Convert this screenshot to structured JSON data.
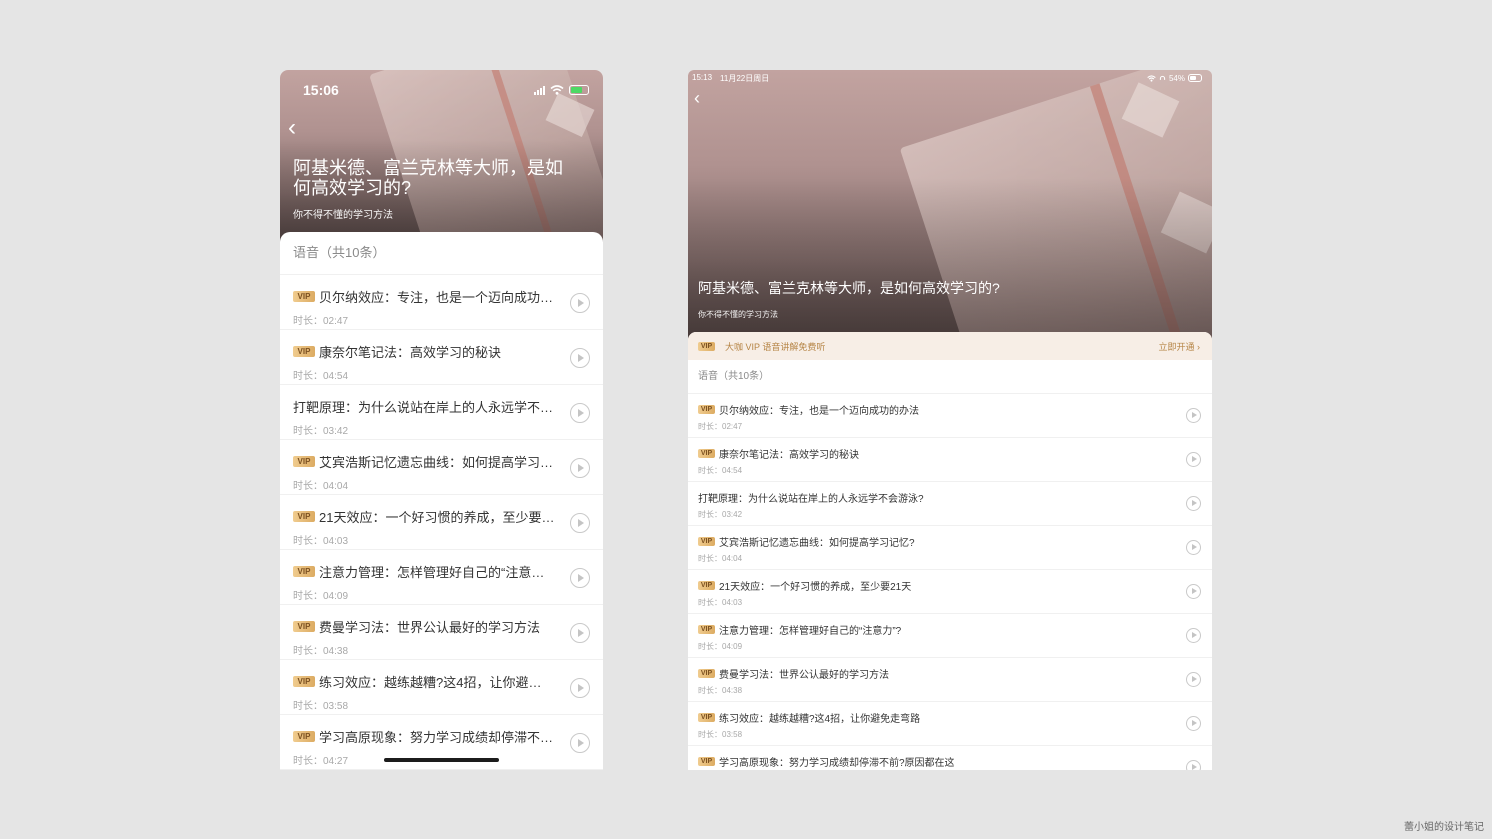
{
  "phone": {
    "status": {
      "time": "15:06"
    },
    "back_label": "‹",
    "title": "阿基米德、富兰克林等大师，是如何高效学习的?",
    "subtitle": "你不得不懂的学习方法",
    "section_label": "语音（共10条）",
    "vip_badge": "VIP",
    "items": [
      {
        "vip": true,
        "title": "贝尔纳效应：专注，也是一个迈向成功…",
        "duration": "时长：02:47"
      },
      {
        "vip": true,
        "title": "康奈尔笔记法：高效学习的秘诀",
        "duration": "时长：04:54"
      },
      {
        "vip": false,
        "title": "打靶原理：为什么说站在岸上的人永远学不…",
        "duration": "时长：03:42"
      },
      {
        "vip": true,
        "title": "艾宾浩斯记忆遗忘曲线：如何提高学习…",
        "duration": "时长：04:04"
      },
      {
        "vip": true,
        "title": "21天效应：一个好习惯的养成，至少要…",
        "duration": "时长：04:03"
      },
      {
        "vip": true,
        "title": "注意力管理：怎样管理好自己的“注意…",
        "duration": "时长：04:09"
      },
      {
        "vip": true,
        "title": "费曼学习法：世界公认最好的学习方法",
        "duration": "时长：04:38"
      },
      {
        "vip": true,
        "title": "练习效应：越练越糟?这4招，让你避…",
        "duration": "时长：03:58"
      },
      {
        "vip": true,
        "title": "学习高原现象：努力学习成绩却停滞不…",
        "duration": "时长：04:27"
      }
    ]
  },
  "tablet": {
    "status": {
      "time": "15:13",
      "date": "11月22日周日",
      "battery": "54%"
    },
    "back_label": "‹",
    "title": "阿基米德、富兰克林等大师，是如何高效学习的?",
    "subtitle": "你不得不懂的学习方法",
    "vip_banner": {
      "text": "大咖 VIP 语音讲解免费听",
      "action": "立即开通 ›"
    },
    "section_label": "语音（共10条）",
    "vip_badge": "VIP",
    "items": [
      {
        "vip": true,
        "title": "贝尔纳效应：专注，也是一个迈向成功的办法",
        "duration": "时长：02:47"
      },
      {
        "vip": true,
        "title": "康奈尔笔记法：高效学习的秘诀",
        "duration": "时长：04:54"
      },
      {
        "vip": false,
        "title": "打靶原理：为什么说站在岸上的人永远学不会游泳?",
        "duration": "时长：03:42"
      },
      {
        "vip": true,
        "title": "艾宾浩斯记忆遗忘曲线：如何提高学习记忆?",
        "duration": "时长：04:04"
      },
      {
        "vip": true,
        "title": "21天效应：一个好习惯的养成，至少要21天",
        "duration": "时长：04:03"
      },
      {
        "vip": true,
        "title": "注意力管理：怎样管理好自己的“注意力”?",
        "duration": "时长：04:09"
      },
      {
        "vip": true,
        "title": "费曼学习法：世界公认最好的学习方法",
        "duration": "时长：04:38"
      },
      {
        "vip": true,
        "title": "练习效应：越练越糟?这4招，让你避免走弯路",
        "duration": "时长：03:58"
      },
      {
        "vip": true,
        "title": "学习高原现象：努力学习成绩却停滞不前?原因都在这",
        "duration": ""
      }
    ]
  },
  "watermark": "蕾小姐的设计笔记",
  "colors": {
    "background": "#e5e5e5",
    "vip_gold": "#dcab62",
    "banner_bg": "#f7eee6",
    "hero_pink": "#c2a3a0"
  },
  "icons": [
    "back-chevron-icon",
    "signal-icon",
    "wifi-icon",
    "battery-icon",
    "headphones-icon",
    "play-icon"
  ]
}
